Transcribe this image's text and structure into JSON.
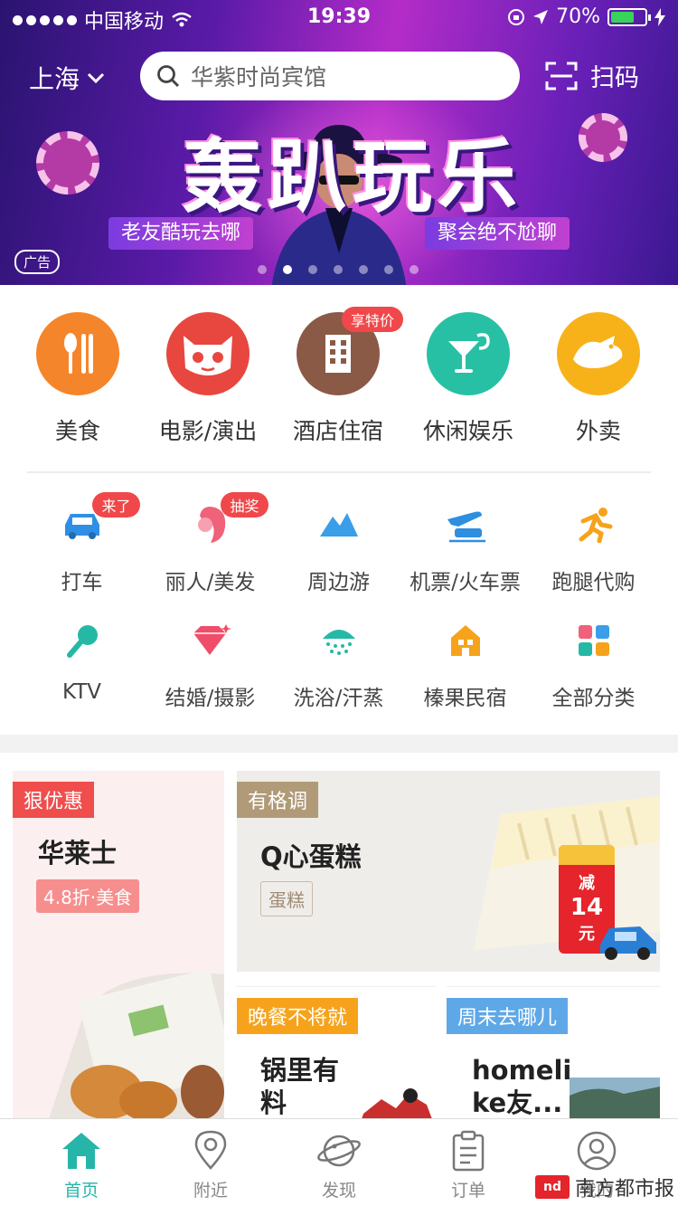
{
  "status_bar": {
    "carrier": "中国移动",
    "time": "19:39",
    "battery": "70%",
    "battery_level": 0.7
  },
  "header": {
    "city": "上海",
    "search_placeholder": "华紫时尚宾馆",
    "scan_label": "扫码"
  },
  "banner": {
    "title": "轰趴玩乐",
    "left_slogan": "老友酷玩去哪",
    "right_slogan": "聚会绝不尬聊",
    "ad_tag": "广告",
    "slide_count": 7,
    "active_slide": 1
  },
  "main_categories": [
    {
      "label": "美食",
      "icon": "fork-knife-icon",
      "color": "#f5852a"
    },
    {
      "label": "电影/演出",
      "icon": "cat-face-icon",
      "color": "#e8473f"
    },
    {
      "label": "酒店住宿",
      "icon": "building-icon",
      "color": "#8a5a47",
      "badge": "享特价"
    },
    {
      "label": "休闲娱乐",
      "icon": "cocktail-icon",
      "color": "#27c0a5"
    },
    {
      "label": "外卖",
      "icon": "kangaroo-icon",
      "color": "#f7b21a"
    }
  ],
  "sub_categories": [
    {
      "label": "打车",
      "icon": "car-icon",
      "color": "#2f8fe6",
      "badge": "来了"
    },
    {
      "label": "丽人/美发",
      "icon": "lady-icon",
      "color": "#f0627a",
      "badge": "抽奖"
    },
    {
      "label": "周边游",
      "icon": "mountain-icon",
      "color": "#3a9ee8"
    },
    {
      "label": "机票/火车票",
      "icon": "plane-train-icon",
      "color": "#2e8ee0"
    },
    {
      "label": "跑腿代购",
      "icon": "runner-icon",
      "color": "#f6a31b"
    },
    {
      "label": "KTV",
      "icon": "microphone-icon",
      "color": "#25b9a5"
    },
    {
      "label": "结婚/摄影",
      "icon": "diamond-icon",
      "color": "#f04d6a"
    },
    {
      "label": "洗浴/汗蒸",
      "icon": "shower-icon",
      "color": "#25b9a5"
    },
    {
      "label": "榛果民宿",
      "icon": "house-icon",
      "color": "#f6a31b"
    },
    {
      "label": "全部分类",
      "icon": "grid-icon",
      "color": "#3a9ee8"
    }
  ],
  "promo_cards": {
    "card1": {
      "tag": "狠优惠",
      "title": "华莱士",
      "subtitle": "4.8折·美食"
    },
    "card2": {
      "tag": "有格调",
      "title": "Q心蛋糕",
      "subtitle": "蛋糕",
      "coupon_top": "减",
      "coupon_num": "14",
      "coupon_unit": "元"
    },
    "card3": {
      "tag": "晚餐不将就",
      "title": "锅里有\n料"
    },
    "card4": {
      "tag": "周末去哪儿",
      "title": "homeli\nke友..."
    }
  },
  "tab_bar": [
    {
      "label": "首页",
      "icon": "home-icon",
      "active": true
    },
    {
      "label": "附近",
      "icon": "location-pin-icon",
      "active": false
    },
    {
      "label": "发现",
      "icon": "planet-icon",
      "active": false
    },
    {
      "label": "订单",
      "icon": "clipboard-icon",
      "active": false
    },
    {
      "label": "我的",
      "icon": "user-icon",
      "active": false
    }
  ],
  "watermark": {
    "logo": "nd",
    "text": "南方都市报"
  },
  "colors": {
    "accent": "#26b5a8",
    "badge_red": "#f0484a"
  }
}
